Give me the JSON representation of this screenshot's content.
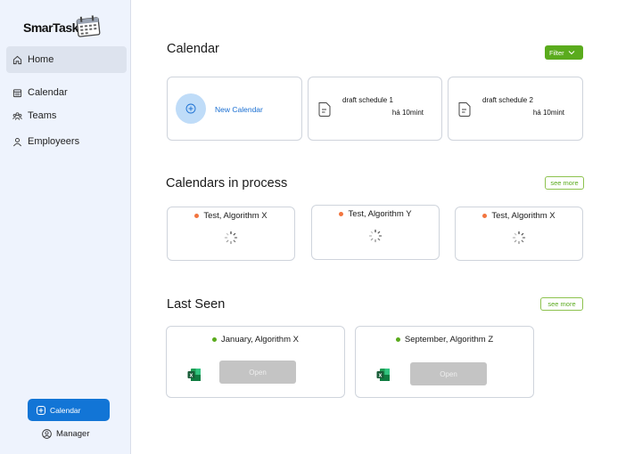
{
  "brand": {
    "name": "SmarTask"
  },
  "sidebar": {
    "items": [
      {
        "label": "Home",
        "icon": "home-icon"
      },
      {
        "label": "Calendar",
        "icon": "calendar-icon"
      },
      {
        "label": "Teams",
        "icon": "teams-icon"
      },
      {
        "label": "Employeers",
        "icon": "user-icon"
      }
    ],
    "calendar_button": "Calendar",
    "manager_label": "Manager"
  },
  "calendar_section": {
    "title": "Calendar",
    "filter_label": "Filter",
    "new_calendar_label": "New Calendar",
    "drafts": [
      {
        "name": "draft schedule 1",
        "time": "há 10mint"
      },
      {
        "name": "draft schedule 2",
        "time": "há 10mint"
      }
    ]
  },
  "process_section": {
    "title": "Calendars in process",
    "see_more": "see more",
    "items": [
      {
        "label": "Test, Algorithm X"
      },
      {
        "label": "Test, Algorithm Y"
      },
      {
        "label": "Test, Algorithm X"
      }
    ]
  },
  "last_seen_section": {
    "title": "Last Seen",
    "see_more": "see more",
    "items": [
      {
        "label": "January, Algorithm X",
        "open_label": "Open"
      },
      {
        "label": "September, Algorithm Z",
        "open_label": "Open"
      }
    ]
  },
  "colors": {
    "accent_blue": "#1275d6",
    "accent_green": "#5aab1d",
    "status_orange": "#f2753f",
    "sidebar_bg": "#eef3fd"
  }
}
